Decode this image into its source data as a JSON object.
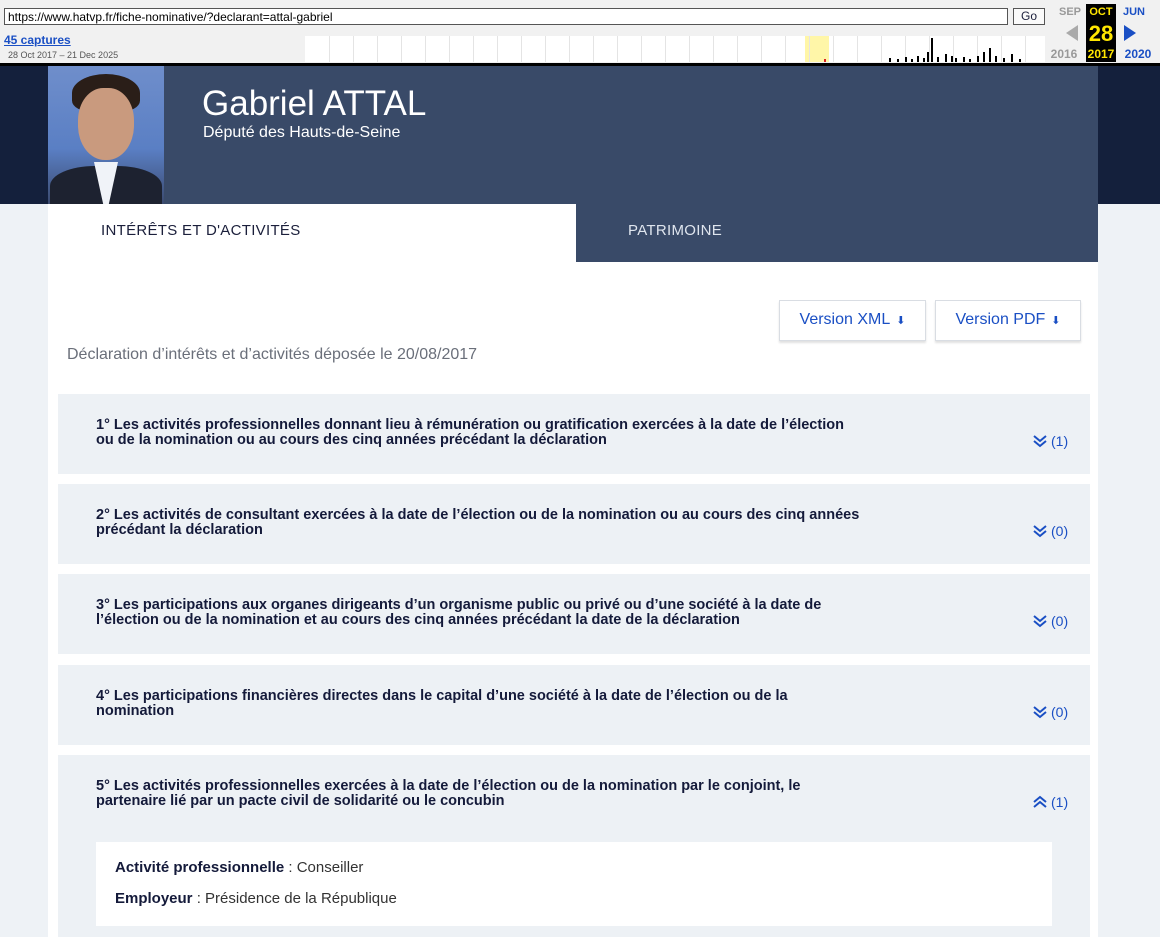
{
  "wayback": {
    "url": "https://www.hatvp.fr/fiche-nominative/?declarant=attal-gabriel",
    "go_label": "Go",
    "captures_label": "45 captures",
    "range_label": "28 Oct 2017 – 21 Dec 2025",
    "months": [
      "SEP",
      "OCT",
      "JUN"
    ],
    "day": "28",
    "years": [
      "2016",
      "2017",
      "2020"
    ]
  },
  "profile": {
    "name": "Gabriel ATTAL",
    "role": "Député des Hauts-de-Seine"
  },
  "tabs": [
    {
      "label": "INTÉRÊTS ET D'ACTIVITÉS",
      "active": true
    },
    {
      "label": "PATRIMOINE",
      "active": false
    }
  ],
  "buttons": {
    "xml_label": "Version XML",
    "pdf_label": "Version PDF",
    "download_glyph": "⬇"
  },
  "declaration_date_text": "Déclaration d’intérêts et d’activités déposée le 20/08/2017",
  "sections": [
    {
      "title_line1": "1° Les activités professionnelles donnant lieu à rémunération ou gratification exercées à la date de l’élection",
      "title_line2": "ou de la nomination ou au cours des cinq années précédant la déclaration",
      "count": "(1)",
      "expanded": false
    },
    {
      "title_line1": "2° Les activités de consultant exercées à la date de l’élection ou de la nomination ou au cours des cinq années",
      "title_line2": "précédant la déclaration",
      "count": "(0)",
      "expanded": false
    },
    {
      "title_line1": "3° Les participations aux organes dirigeants d’un organisme public ou privé ou d’une société à la date de",
      "title_line2": "l’élection ou de la nomination et au cours des cinq années précédant la date de la déclaration",
      "count": "(0)",
      "expanded": false
    },
    {
      "title_line1": "4° Les participations financières directes dans le capital d’une société à la date de l’élection ou de la",
      "title_line2": "nomination",
      "count": "(0)",
      "expanded": false
    },
    {
      "title_line1": "5° Les activités professionnelles exercées à la date de l’élection ou de la nomination par le conjoint, le",
      "title_line2": "partenaire lié par un pacte civil de solidarité ou le concubin",
      "count": "(1)",
      "expanded": true
    }
  ],
  "detail": {
    "activity_label": "Activité professionnelle",
    "activity_value": " : Conseiller",
    "employer_label": "Employeur",
    "employer_value": " : Présidence de la République"
  },
  "colors": {
    "accent": "#1a4fc4",
    "header": "#394a68",
    "header_dark": "#14203c",
    "section_bg": "#edf1f5"
  }
}
